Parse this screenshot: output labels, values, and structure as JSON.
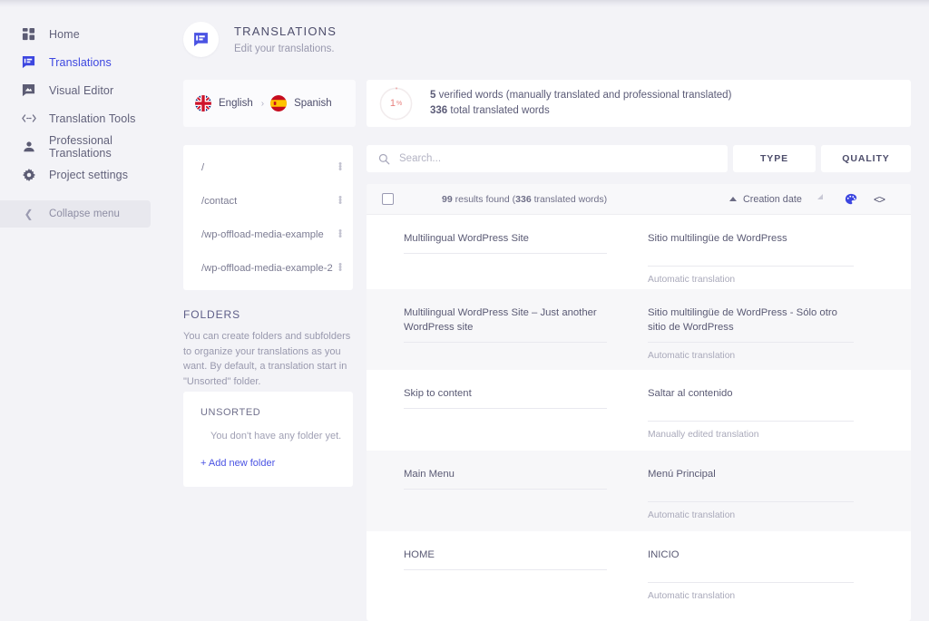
{
  "sidebar": {
    "items": [
      {
        "label": "Home",
        "icon": "dashboard-grid-icon",
        "active": false
      },
      {
        "label": "Translations",
        "icon": "translations-bubble-icon",
        "active": true
      },
      {
        "label": "Visual Editor",
        "icon": "visual-editor-icon",
        "active": false
      },
      {
        "label": "Translation Tools",
        "icon": "code-arrows-icon",
        "active": false
      },
      {
        "label": "Professional Translations",
        "icon": "person-icon",
        "active": false
      },
      {
        "label": "Project settings",
        "icon": "gear-icon",
        "active": false
      }
    ],
    "collapse": {
      "label": "Collapse menu",
      "icon": "chevron-left-icon"
    }
  },
  "header": {
    "title": "TRANSLATIONS",
    "subtitle": "Edit your translations.",
    "badge_icon": "translations-bubble-icon"
  },
  "languages": {
    "source": {
      "name": "English",
      "flag": "uk-flag-icon"
    },
    "arrow": "›",
    "target": {
      "name": "Spanish",
      "flag": "spain-flag-icon"
    }
  },
  "stats": {
    "percent": "1",
    "percent_symbol": "%",
    "verified_count": "5",
    "verified_text": " verified words (manually translated and professional translated)",
    "total_count": "336",
    "total_text": " total translated words"
  },
  "paths": {
    "items": [
      {
        "label": "/"
      },
      {
        "label": "/contact"
      },
      {
        "label": "/wp-offload-media-example"
      },
      {
        "label": "/wp-offload-media-example-2"
      }
    ],
    "menu_icon": "kebab-menu-icon"
  },
  "folders": {
    "title": "FOLDERS",
    "description": "You can create folders and subfolders to organize your translations as you want. By default, a translation start in \"Unsorted\" folder.",
    "unsorted_label": "UNSORTED",
    "empty_text": "You don't have any folder yet.",
    "add_label": "+ Add new folder"
  },
  "search": {
    "placeholder": "Search...",
    "value": "",
    "icon": "search-icon"
  },
  "filters": {
    "type_label": "TYPE",
    "quality_label": "QUALITY"
  },
  "table": {
    "select_all_icon": "checkbox-icon",
    "results_count": "99",
    "results_text": " results found (",
    "results_words": "336",
    "results_suffix": " translated words)",
    "sort_label": "Creation date",
    "sort_direction_icon": "triangle-up-icon",
    "palette_icon": "palette-icon",
    "code_icon": "code-brackets-icon",
    "rows": [
      {
        "source": "Multilingual WordPress Site",
        "target": "Sitio multilingüe de WordPress",
        "meta": "Automatic translation"
      },
      {
        "source": "Multilingual WordPress Site – Just another WordPress site",
        "target": "Sitio multilingüe de WordPress - Sólo otro sitio de WordPress",
        "meta": "Automatic translation"
      },
      {
        "source": "Skip to content",
        "target": "Saltar al contenido",
        "meta": "Manually edited translation"
      },
      {
        "source": "Main Menu",
        "target": "Menú Principal",
        "meta": "Automatic translation"
      },
      {
        "source": "HOME",
        "target": "INICIO",
        "meta": "Automatic translation"
      }
    ]
  },
  "colors": {
    "accent": "#3c46e0",
    "page_bg": "#f3f3f7",
    "card_bg": "#ffffff",
    "text": "#5a5a74",
    "muted": "#a0a0b4",
    "progress": "#e8817f"
  }
}
